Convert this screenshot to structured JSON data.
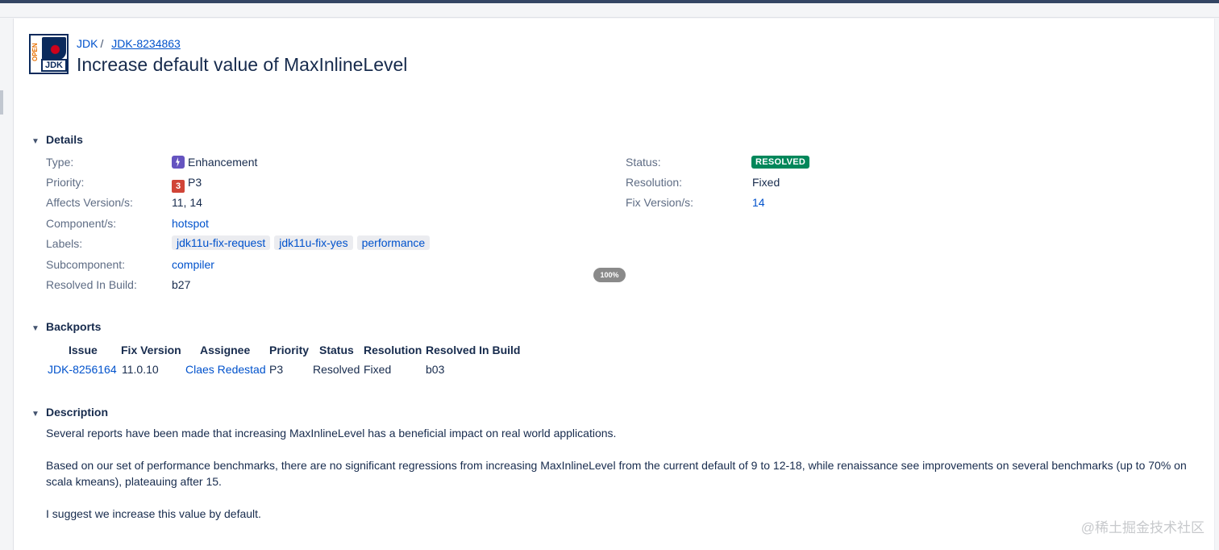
{
  "breadcrumb": {
    "project": "JDK",
    "separator": "/",
    "issue_key": "JDK-8234863"
  },
  "issue": {
    "title": "Increase default value of MaxInlineLevel"
  },
  "sections": {
    "details": "Details",
    "backports": "Backports",
    "description": "Description"
  },
  "details": {
    "type": {
      "label": "Type:",
      "value": "Enhancement",
      "icon": "enhancement-icon"
    },
    "priority": {
      "label": "Priority:",
      "value": "P3",
      "icon_text": "3"
    },
    "affects_versions": {
      "label": "Affects Version/s:",
      "value": "11, 14"
    },
    "components": {
      "label": "Component/s:",
      "value": "hotspot"
    },
    "labels": {
      "label": "Labels:",
      "values": [
        "jdk11u-fix-request",
        "jdk11u-fix-yes",
        "performance"
      ]
    },
    "subcomponent": {
      "label": "Subcomponent:",
      "value": "compiler"
    },
    "resolved_in_build": {
      "label": "Resolved In Build:",
      "value": "b27"
    },
    "status": {
      "label": "Status:",
      "value": "RESOLVED",
      "color": "#00875a"
    },
    "resolution": {
      "label": "Resolution:",
      "value": "Fixed"
    },
    "fix_versions": {
      "label": "Fix Version/s:",
      "value": "14"
    }
  },
  "zoom_badge": "100%",
  "backports": {
    "headers": [
      "Issue",
      "Fix Version",
      "Assignee",
      "Priority",
      "Status",
      "Resolution",
      "Resolved In Build"
    ],
    "rows": [
      {
        "issue": "JDK-8256164",
        "fix_version": "11.0.10",
        "assignee": "Claes Redestad",
        "priority": "P3",
        "status": "Resolved",
        "resolution": "Fixed",
        "build": "b03"
      }
    ]
  },
  "description": {
    "paragraphs": [
      "Several reports have been made that increasing MaxInlineLevel has a beneficial impact on real world applications.",
      "Based on our set of performance benchmarks, there are no significant regressions from increasing MaxInlineLevel from the current default of 9 to 12-18, while renaissance see improvements on several benchmarks (up to 70% on scala kmeans), plateauing after 15.",
      "I suggest we increase this value by default."
    ]
  },
  "watermark": "@稀土掘金技术社区",
  "colors": {
    "link": "#0052cc",
    "resolved_lozenge": "#00875a",
    "enhancement_icon": "#6554c0",
    "priority_icon": "#d04437"
  }
}
